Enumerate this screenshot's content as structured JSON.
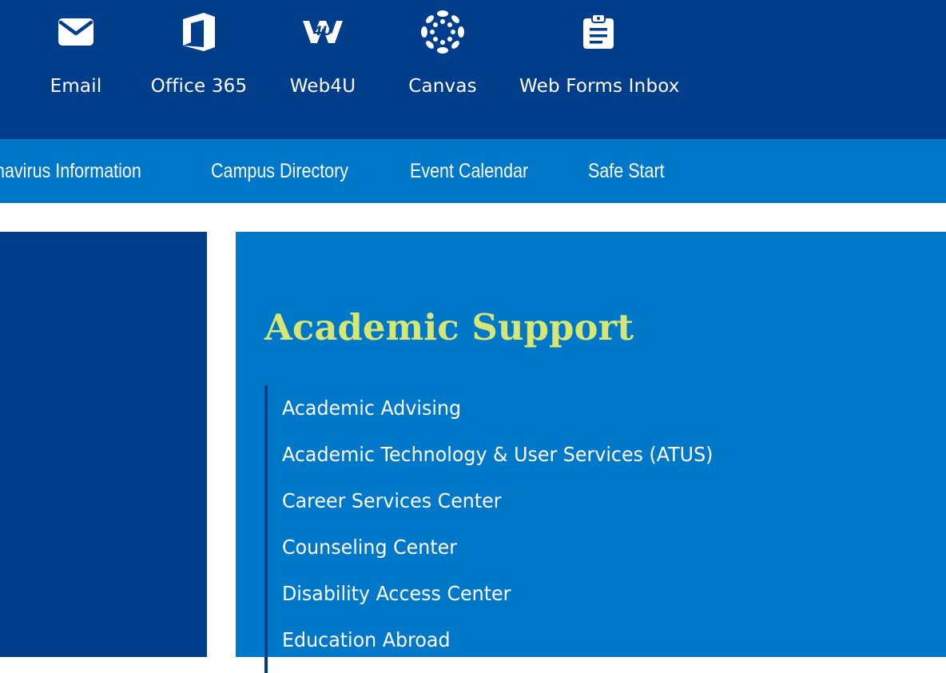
{
  "tools": [
    {
      "label": "Email",
      "icon": "envelope-icon"
    },
    {
      "label": "Office 365",
      "icon": "office-icon"
    },
    {
      "label": "Web4U",
      "icon": "web4u-icon"
    },
    {
      "label": "Canvas",
      "icon": "canvas-icon"
    },
    {
      "label": "Web Forms Inbox",
      "icon": "clipboard-icon"
    }
  ],
  "quick_nav": [
    {
      "label": "navirus Information"
    },
    {
      "label": "Campus Directory"
    },
    {
      "label": "Event Calendar"
    },
    {
      "label": "Safe Start"
    }
  ],
  "section": {
    "title": "Academic Support",
    "links": [
      "Academic Advising",
      "Academic Technology & User Services (ATUS)",
      "Career Services Center",
      "Counseling Center",
      "Disability Access Center",
      "Education Abroad"
    ]
  },
  "colors": {
    "dark_blue": "#003d8a",
    "bright_blue": "#0078c9",
    "title_yellow_green": "#d6e675",
    "white": "#ffffff"
  }
}
